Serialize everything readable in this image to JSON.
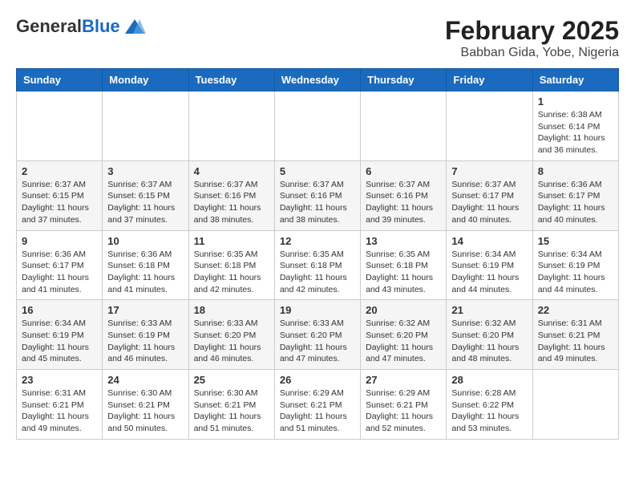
{
  "header": {
    "logo_general": "General",
    "logo_blue": "Blue",
    "month_title": "February 2025",
    "location": "Babban Gida, Yobe, Nigeria"
  },
  "days_of_week": [
    "Sunday",
    "Monday",
    "Tuesday",
    "Wednesday",
    "Thursday",
    "Friday",
    "Saturday"
  ],
  "weeks": [
    [
      {
        "day": "",
        "info": ""
      },
      {
        "day": "",
        "info": ""
      },
      {
        "day": "",
        "info": ""
      },
      {
        "day": "",
        "info": ""
      },
      {
        "day": "",
        "info": ""
      },
      {
        "day": "",
        "info": ""
      },
      {
        "day": "1",
        "info": "Sunrise: 6:38 AM\nSunset: 6:14 PM\nDaylight: 11 hours\nand 36 minutes."
      }
    ],
    [
      {
        "day": "2",
        "info": "Sunrise: 6:37 AM\nSunset: 6:15 PM\nDaylight: 11 hours\nand 37 minutes."
      },
      {
        "day": "3",
        "info": "Sunrise: 6:37 AM\nSunset: 6:15 PM\nDaylight: 11 hours\nand 37 minutes."
      },
      {
        "day": "4",
        "info": "Sunrise: 6:37 AM\nSunset: 6:16 PM\nDaylight: 11 hours\nand 38 minutes."
      },
      {
        "day": "5",
        "info": "Sunrise: 6:37 AM\nSunset: 6:16 PM\nDaylight: 11 hours\nand 38 minutes."
      },
      {
        "day": "6",
        "info": "Sunrise: 6:37 AM\nSunset: 6:16 PM\nDaylight: 11 hours\nand 39 minutes."
      },
      {
        "day": "7",
        "info": "Sunrise: 6:37 AM\nSunset: 6:17 PM\nDaylight: 11 hours\nand 40 minutes."
      },
      {
        "day": "8",
        "info": "Sunrise: 6:36 AM\nSunset: 6:17 PM\nDaylight: 11 hours\nand 40 minutes."
      }
    ],
    [
      {
        "day": "9",
        "info": "Sunrise: 6:36 AM\nSunset: 6:17 PM\nDaylight: 11 hours\nand 41 minutes."
      },
      {
        "day": "10",
        "info": "Sunrise: 6:36 AM\nSunset: 6:18 PM\nDaylight: 11 hours\nand 41 minutes."
      },
      {
        "day": "11",
        "info": "Sunrise: 6:35 AM\nSunset: 6:18 PM\nDaylight: 11 hours\nand 42 minutes."
      },
      {
        "day": "12",
        "info": "Sunrise: 6:35 AM\nSunset: 6:18 PM\nDaylight: 11 hours\nand 42 minutes."
      },
      {
        "day": "13",
        "info": "Sunrise: 6:35 AM\nSunset: 6:18 PM\nDaylight: 11 hours\nand 43 minutes."
      },
      {
        "day": "14",
        "info": "Sunrise: 6:34 AM\nSunset: 6:19 PM\nDaylight: 11 hours\nand 44 minutes."
      },
      {
        "day": "15",
        "info": "Sunrise: 6:34 AM\nSunset: 6:19 PM\nDaylight: 11 hours\nand 44 minutes."
      }
    ],
    [
      {
        "day": "16",
        "info": "Sunrise: 6:34 AM\nSunset: 6:19 PM\nDaylight: 11 hours\nand 45 minutes."
      },
      {
        "day": "17",
        "info": "Sunrise: 6:33 AM\nSunset: 6:19 PM\nDaylight: 11 hours\nand 46 minutes."
      },
      {
        "day": "18",
        "info": "Sunrise: 6:33 AM\nSunset: 6:20 PM\nDaylight: 11 hours\nand 46 minutes."
      },
      {
        "day": "19",
        "info": "Sunrise: 6:33 AM\nSunset: 6:20 PM\nDaylight: 11 hours\nand 47 minutes."
      },
      {
        "day": "20",
        "info": "Sunrise: 6:32 AM\nSunset: 6:20 PM\nDaylight: 11 hours\nand 47 minutes."
      },
      {
        "day": "21",
        "info": "Sunrise: 6:32 AM\nSunset: 6:20 PM\nDaylight: 11 hours\nand 48 minutes."
      },
      {
        "day": "22",
        "info": "Sunrise: 6:31 AM\nSunset: 6:21 PM\nDaylight: 11 hours\nand 49 minutes."
      }
    ],
    [
      {
        "day": "23",
        "info": "Sunrise: 6:31 AM\nSunset: 6:21 PM\nDaylight: 11 hours\nand 49 minutes."
      },
      {
        "day": "24",
        "info": "Sunrise: 6:30 AM\nSunset: 6:21 PM\nDaylight: 11 hours\nand 50 minutes."
      },
      {
        "day": "25",
        "info": "Sunrise: 6:30 AM\nSunset: 6:21 PM\nDaylight: 11 hours\nand 51 minutes."
      },
      {
        "day": "26",
        "info": "Sunrise: 6:29 AM\nSunset: 6:21 PM\nDaylight: 11 hours\nand 51 minutes."
      },
      {
        "day": "27",
        "info": "Sunrise: 6:29 AM\nSunset: 6:21 PM\nDaylight: 11 hours\nand 52 minutes."
      },
      {
        "day": "28",
        "info": "Sunrise: 6:28 AM\nSunset: 6:22 PM\nDaylight: 11 hours\nand 53 minutes."
      },
      {
        "day": "",
        "info": ""
      }
    ]
  ]
}
